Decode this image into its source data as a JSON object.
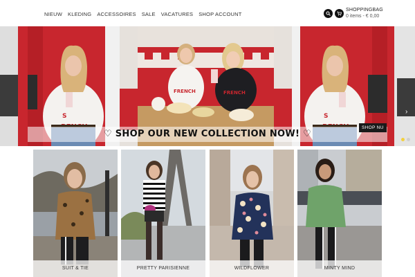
{
  "nav": {
    "items": [
      "NIEUW",
      "KLEDING",
      "ACCESSOIRES",
      "SALE",
      "VACATURES",
      "SHOP ACCOUNT"
    ]
  },
  "header": {
    "search_icon": "search-icon",
    "cart_icon": "cart-icon",
    "bag_title": "SHOPPINGBAG",
    "bag_summary": "0 items - € 0,00"
  },
  "hero": {
    "caption": "♡ SHOP OUR NEW COLLECTION NOW! ♡",
    "cta": "SHOP NU",
    "slide_dots": 2
  },
  "collections": [
    {
      "label": "SUIT & TIE"
    },
    {
      "label": "PRETTY PARISIENNE"
    },
    {
      "label": "WILDFLOWER"
    },
    {
      "label": "MINTY MIND"
    }
  ],
  "colors": {
    "accent_red": "#c8262e",
    "dot_active": "#f3d03e",
    "dark": "#1a1a1a"
  }
}
